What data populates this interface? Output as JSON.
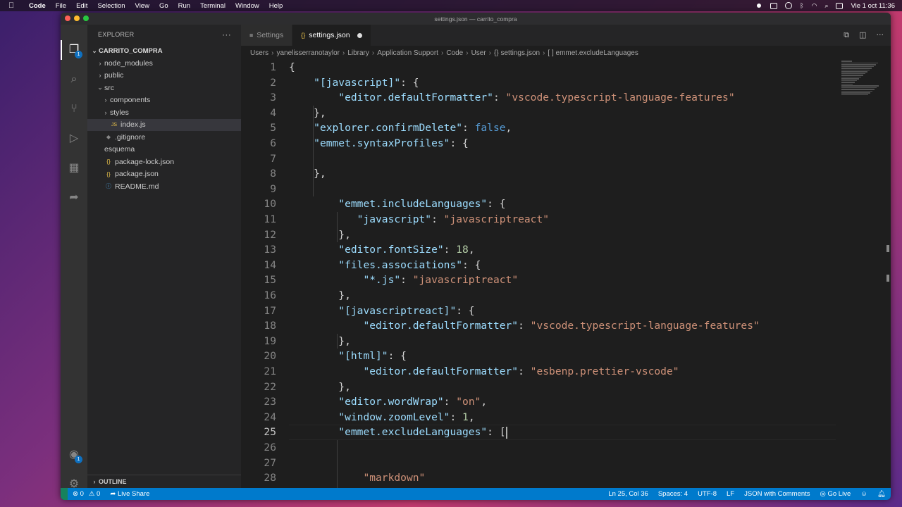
{
  "menubar": {
    "app": "Code",
    "items": [
      "File",
      "Edit",
      "Selection",
      "View",
      "Go",
      "Run",
      "Terminal",
      "Window",
      "Help"
    ],
    "clock": "Vie 1 oct  11:36"
  },
  "window": {
    "title": "settings.json — carrito_compra"
  },
  "activity_bar": {
    "explorer_badge": "1",
    "accounts_badge": "1"
  },
  "sidebar": {
    "title": "EXPLORER",
    "more": "···",
    "root": "CARRITO_COMPRA",
    "items": [
      {
        "label": "node_modules",
        "depth": 1,
        "chevron": "›",
        "icon": ""
      },
      {
        "label": "public",
        "depth": 1,
        "chevron": "›",
        "icon": ""
      },
      {
        "label": "src",
        "depth": 1,
        "chevron": "⌄",
        "icon": ""
      },
      {
        "label": "components",
        "depth": 2,
        "chevron": "›",
        "icon": ""
      },
      {
        "label": "styles",
        "depth": 2,
        "chevron": "›",
        "icon": ""
      },
      {
        "label": "index.js",
        "depth": 2,
        "chevron": "",
        "icon": "JS",
        "selected": true
      },
      {
        "label": ".gitignore",
        "depth": 1,
        "chevron": "",
        "icon": "◆"
      },
      {
        "label": "esquema",
        "depth": 1,
        "chevron": "",
        "icon": ""
      },
      {
        "label": "package-lock.json",
        "depth": 1,
        "chevron": "",
        "icon": "{}"
      },
      {
        "label": "package.json",
        "depth": 1,
        "chevron": "",
        "icon": "{}"
      },
      {
        "label": "README.md",
        "depth": 1,
        "chevron": "",
        "icon": "ⓘ"
      }
    ],
    "outline": "OUTLINE"
  },
  "tabs": [
    {
      "label": "Settings",
      "icon": "≡",
      "active": false
    },
    {
      "label": "settings.json",
      "icon": "{}",
      "active": true
    }
  ],
  "breadcrumb": [
    "Users",
    "yanelisserranotaylor",
    "Library",
    "Application Support",
    "Code",
    "User",
    "{} settings.json",
    "[ ] emmet.excludeLanguages"
  ],
  "code": {
    "current_line": 25,
    "lines": [
      [
        [
          "p",
          "{"
        ]
      ],
      [
        [
          "p",
          "    "
        ],
        [
          "k",
          "\"[javascript]\""
        ],
        [
          "p",
          ": {"
        ]
      ],
      [
        [
          "p",
          "        "
        ],
        [
          "k",
          "\"editor.defaultFormatter\""
        ],
        [
          "p",
          ": "
        ],
        [
          "s",
          "\"vscode.typescript-language-features\""
        ]
      ],
      [
        [
          "p",
          "    },"
        ]
      ],
      [
        [
          "p",
          "    "
        ],
        [
          "k",
          "\"explorer.confirmDelete\""
        ],
        [
          "p",
          ": "
        ],
        [
          "b",
          "false"
        ],
        [
          "p",
          ","
        ]
      ],
      [
        [
          "p",
          "    "
        ],
        [
          "k",
          "\"emmet.syntaxProfiles\""
        ],
        [
          "p",
          ": {"
        ]
      ],
      [
        [
          "p",
          ""
        ]
      ],
      [
        [
          "p",
          "    },"
        ]
      ],
      [
        [
          "p",
          ""
        ]
      ],
      [
        [
          "p",
          "        "
        ],
        [
          "k",
          "\"emmet.includeLanguages\""
        ],
        [
          "p",
          ": {"
        ]
      ],
      [
        [
          "p",
          "           "
        ],
        [
          "k",
          "\"javascript\""
        ],
        [
          "p",
          ": "
        ],
        [
          "s",
          "\"javascriptreact\""
        ]
      ],
      [
        [
          "p",
          "        },"
        ]
      ],
      [
        [
          "p",
          "        "
        ],
        [
          "k",
          "\"editor.fontSize\""
        ],
        [
          "p",
          ": "
        ],
        [
          "n",
          "18"
        ],
        [
          "p",
          ","
        ]
      ],
      [
        [
          "p",
          "        "
        ],
        [
          "k",
          "\"files.associations\""
        ],
        [
          "p",
          ": {"
        ]
      ],
      [
        [
          "p",
          "            "
        ],
        [
          "k",
          "\"*.js\""
        ],
        [
          "p",
          ": "
        ],
        [
          "s",
          "\"javascriptreact\""
        ]
      ],
      [
        [
          "p",
          "        },"
        ]
      ],
      [
        [
          "p",
          "        "
        ],
        [
          "k",
          "\"[javascriptreact]\""
        ],
        [
          "p",
          ": {"
        ]
      ],
      [
        [
          "p",
          "            "
        ],
        [
          "k",
          "\"editor.defaultFormatter\""
        ],
        [
          "p",
          ": "
        ],
        [
          "s",
          "\"vscode.typescript-language-features\""
        ]
      ],
      [
        [
          "p",
          "        },"
        ]
      ],
      [
        [
          "p",
          "        "
        ],
        [
          "k",
          "\"[html]\""
        ],
        [
          "p",
          ": {"
        ]
      ],
      [
        [
          "p",
          "            "
        ],
        [
          "k",
          "\"editor.defaultFormatter\""
        ],
        [
          "p",
          ": "
        ],
        [
          "s",
          "\"esbenp.prettier-vscode\""
        ]
      ],
      [
        [
          "p",
          "        },"
        ]
      ],
      [
        [
          "p",
          "        "
        ],
        [
          "k",
          "\"editor.wordWrap\""
        ],
        [
          "p",
          ": "
        ],
        [
          "s",
          "\"on\""
        ],
        [
          "p",
          ","
        ]
      ],
      [
        [
          "p",
          "        "
        ],
        [
          "k",
          "\"window.zoomLevel\""
        ],
        [
          "p",
          ": "
        ],
        [
          "n",
          "1"
        ],
        [
          "p",
          ","
        ]
      ],
      [
        [
          "p",
          "        "
        ],
        [
          "k",
          "\"emmet.excludeLanguages\""
        ],
        [
          "p",
          ": ["
        ]
      ],
      [
        [
          "p",
          ""
        ]
      ],
      [
        [
          "p",
          ""
        ]
      ],
      [
        [
          "p",
          "            "
        ],
        [
          "s",
          "\"markdown\""
        ]
      ],
      [
        [
          "p",
          "        ]"
        ]
      ]
    ]
  },
  "statusbar": {
    "errors": "⊗ 0",
    "warnings": "⚠ 0",
    "liveshare": "Live Share",
    "position": "Ln 25, Col 36",
    "spaces": "Spaces: 4",
    "encoding": "UTF-8",
    "eol": "LF",
    "language": "JSON with Comments",
    "golive": "Go Live"
  }
}
